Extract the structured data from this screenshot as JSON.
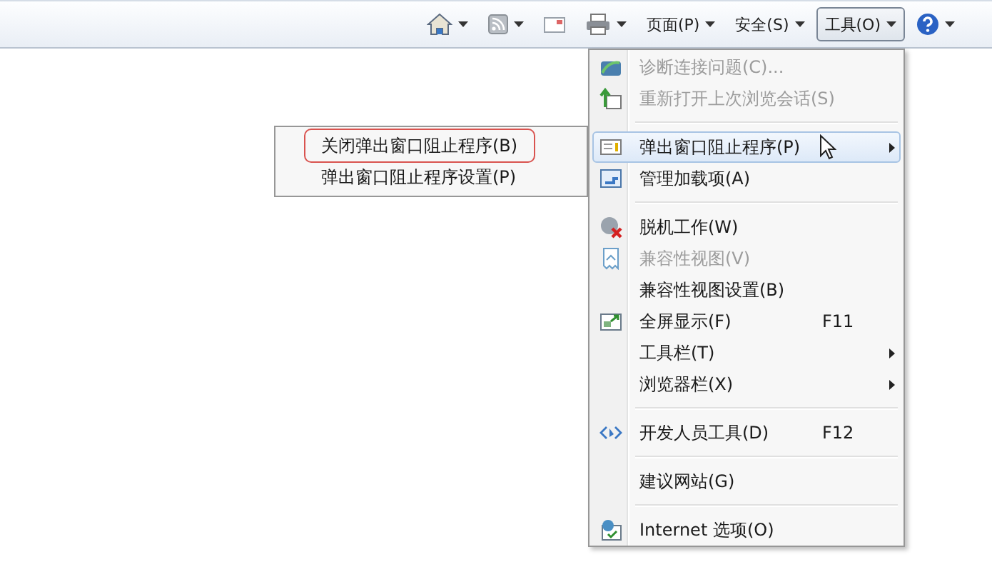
{
  "toolbar": [
    {
      "kind": "home",
      "dropdown": true,
      "selected": false
    },
    {
      "kind": "feeds",
      "dropdown": true,
      "selected": false
    },
    {
      "kind": "mail",
      "dropdown": false,
      "selected": false
    },
    {
      "kind": "print",
      "dropdown": true,
      "selected": false
    },
    {
      "kind": "text",
      "label": "页面(P)",
      "dropdown": true,
      "selected": false
    },
    {
      "kind": "text",
      "label": "安全(S)",
      "dropdown": true,
      "selected": false
    },
    {
      "kind": "text",
      "label": "工具(O)",
      "dropdown": true,
      "selected": true
    },
    {
      "kind": "help",
      "dropdown": true,
      "selected": false
    }
  ],
  "menu": [
    {
      "kind": "diagnose",
      "label": "诊断连接问题(C)...",
      "disabled": true,
      "selected": false
    },
    {
      "kind": "reopen",
      "label": "重新打开上次浏览会话(S)",
      "disabled": true,
      "selected": false
    },
    {
      "kind": "separator"
    },
    {
      "kind": "popup",
      "label": "弹出窗口阻止程序(P)",
      "disabled": false,
      "selected": true,
      "submenu": true
    },
    {
      "kind": "addons",
      "label": "管理加载项(A)",
      "disabled": false,
      "selected": false
    },
    {
      "kind": "separator"
    },
    {
      "kind": "offline",
      "label": "脱机工作(W)",
      "disabled": false,
      "selected": false
    },
    {
      "kind": "compat",
      "label": "兼容性视图(V)",
      "disabled": true,
      "selected": false
    },
    {
      "kind": "plain",
      "label": "兼容性视图设置(B)",
      "disabled": false,
      "selected": false
    },
    {
      "kind": "fullscreen",
      "label": "全屏显示(F)",
      "shortcut": "F11",
      "disabled": false,
      "selected": false
    },
    {
      "kind": "plain",
      "label": "工具栏(T)",
      "disabled": false,
      "selected": false,
      "submenu": true
    },
    {
      "kind": "plain",
      "label": "浏览器栏(X)",
      "disabled": false,
      "selected": false,
      "submenu": true
    },
    {
      "kind": "separator"
    },
    {
      "kind": "devtools",
      "label": "开发人员工具(D)",
      "shortcut": "F12",
      "disabled": false,
      "selected": false
    },
    {
      "kind": "separator"
    },
    {
      "kind": "plain",
      "label": "建议网站(G)",
      "disabled": false,
      "selected": false
    },
    {
      "kind": "separator"
    },
    {
      "kind": "options",
      "label": "Internet 选项(O)",
      "disabled": false,
      "selected": false
    }
  ],
  "submenu": [
    {
      "label": "关闭弹出窗口阻止程序(B)",
      "circled": true
    },
    {
      "label": "弹出窗口阻止程序设置(P)",
      "circled": false
    }
  ]
}
